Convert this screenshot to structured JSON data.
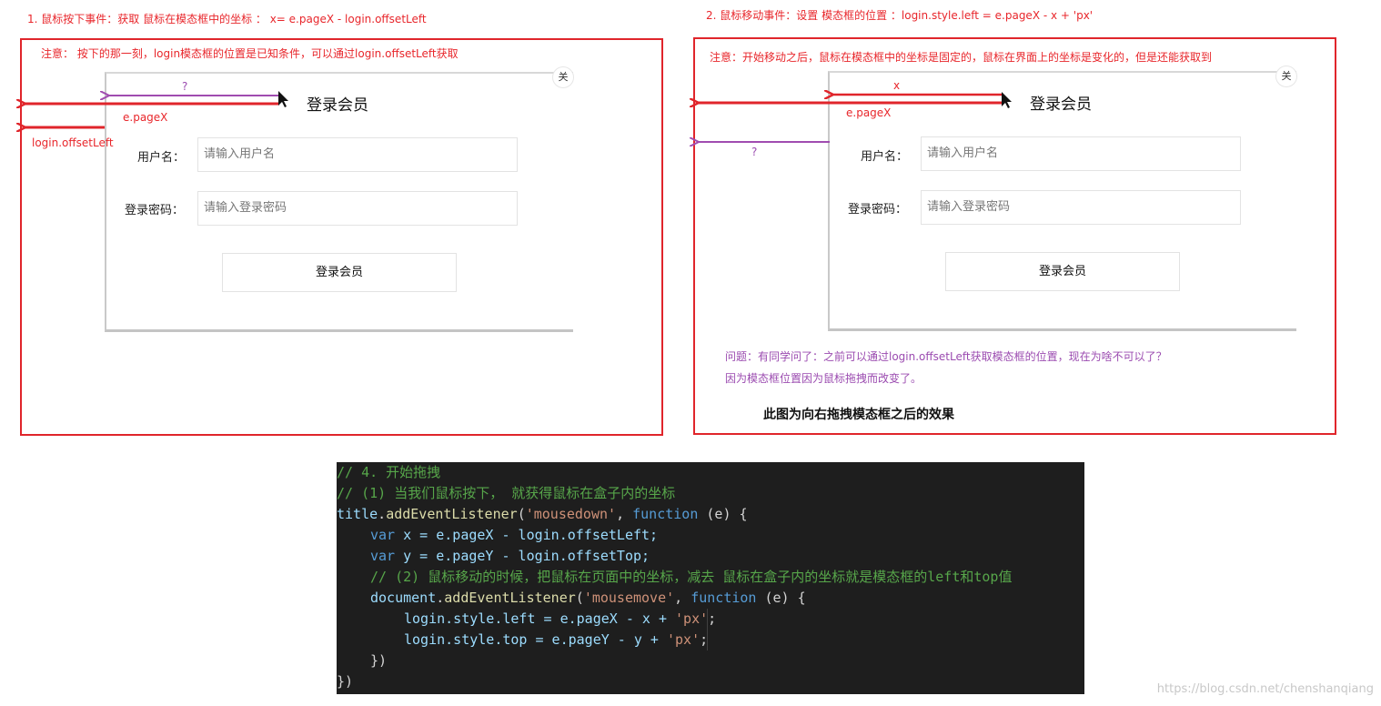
{
  "left_panel": {
    "heading": "1. 鼠标按下事件：获取 鼠标在模态框中的坐标 ： x= e.pageX - login.offsetLeft",
    "note": "注意： 按下的那一刻，login模态框的位置是已知条件，可以通过login.offsetLeft获取",
    "label_question": "?",
    "label_pagex": "e.pageX",
    "label_offsetleft": "login.offsetLeft",
    "modal": {
      "close_glyph": "关",
      "title": "登录会员",
      "username_label": "用户名：",
      "username_placeholder": "请输入用户名",
      "password_label": "登录密码：",
      "password_placeholder": "请输入登录密码",
      "submit_label": "登录会员"
    }
  },
  "right_panel": {
    "heading": "2. 鼠标移动事件：设置  模态框的位置  ：login.style.left = e.pageX - x + 'px'",
    "note": "注意：开始移动之后，鼠标在模态框中的坐标是固定的，鼠标在界面上的坐标是变化的，但是还能获取到",
    "label_x": "x",
    "label_pagex": "e.pageX",
    "label_question": "?",
    "question_line1": "问题：有同学问了：之前可以通过login.offsetLeft获取模态框的位置，现在为啥不可以了？",
    "question_line2": "因为模态框位置因为鼠标拖拽而改变了。",
    "caption": "此图为向右拖拽模态框之后的效果",
    "modal": {
      "close_glyph": "关",
      "title": "登录会员",
      "username_label": "用户名：",
      "username_placeholder": "请输入用户名",
      "password_label": "登录密码：",
      "password_placeholder": "请输入登录密码",
      "submit_label": "登录会员"
    }
  },
  "code": {
    "comment1": "// 4. 开始拖拽",
    "comment2": "// (1) 当我们鼠标按下， 就获得鼠标在盒子内的坐标",
    "l3_obj": "title",
    "l3_dot": ".",
    "l3_fn": "addEventListener",
    "l3_open": "(",
    "l3_str": "'mousedown'",
    "l3_comma": ", ",
    "l3_kw": "function",
    "l3_rest": " (e) {",
    "l4_kw": "var",
    "l4_rest": " x = e.pageX - login.offsetLeft;",
    "l5_kw": "var",
    "l5_rest": " y = e.pageY - login.offsetTop;",
    "comment6": "// (2) 鼠标移动的时候，把鼠标在页面中的坐标，减去 鼠标在盒子内的坐标就是模态框的left和top值",
    "l7_obj": "document",
    "l7_dot": ".",
    "l7_fn": "addEventListener",
    "l7_open": "(",
    "l7_str": "'mousemove'",
    "l7_comma": ", ",
    "l7_kw": "function",
    "l7_rest": " (e) {",
    "l8_code": "login.style.left = e.pageX - x + ",
    "l8_str": "'px'",
    "l8_end": ";",
    "l9_code": "login.style.top = e.pageY - y + ",
    "l9_str": "'px'",
    "l9_end": ";",
    "l10": "})",
    "l11": "})"
  },
  "watermark": "https://blog.csdn.net/chenshanqiang",
  "colors": {
    "frame_red": "#e0252b",
    "arrow_red": "#e0252b",
    "arrow_purple": "#a04cb0",
    "code_bg": "#1e1e1e"
  }
}
